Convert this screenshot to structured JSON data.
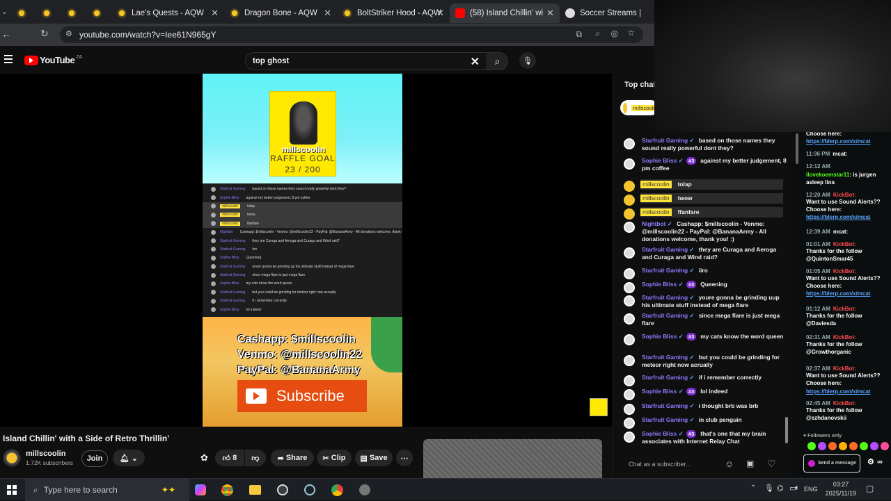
{
  "browser": {
    "tabs": [
      {
        "label": "",
        "active": false
      },
      {
        "label": "",
        "active": false
      },
      {
        "label": "",
        "active": false
      },
      {
        "label": "",
        "active": false
      },
      {
        "label": "Lae's Quests - AQW",
        "active": false
      },
      {
        "label": "Dragon Bone - AQW",
        "active": false
      },
      {
        "label": "BoltStriker Hood - AQW",
        "active": false
      },
      {
        "label": "(58) Island Chillin' wi",
        "active": true
      },
      {
        "label": "Soccer Streams | Watch",
        "active": false
      }
    ],
    "url": "youtube.com/watch?v=Iee61N965gY"
  },
  "youtube": {
    "logo_text": "YouTube",
    "region": "ZA",
    "search_value": "top ghost"
  },
  "video": {
    "poster_name": "millscoolin",
    "poster_goal": "RAFFLE GOAL",
    "poster_count": "23 / 200",
    "donate_cashapp": "Cashapp: $millscoolin",
    "donate_venmo": "Venmo: @millscoolin22",
    "donate_paypal": "PayPal: @BananaArmy",
    "subscribe": "Subscribe",
    "mini_chat": [
      {
        "name": "Starfruit Gaming",
        "text": "based on those names they sound really powerful dont they?",
        "hl": false,
        "y": false
      },
      {
        "name": "Sophie Bliss",
        "text": "against my better judgement, 8 pm coffee",
        "hl": false,
        "y": false
      },
      {
        "name": "millscoolin",
        "text": "tolap",
        "hl": true,
        "y": true
      },
      {
        "name": "millscoolin",
        "text": "twow",
        "hl": true,
        "y": true
      },
      {
        "name": "millscoolin",
        "text": "ffanfare",
        "hl": true,
        "y": true
      },
      {
        "name": "Nightbot",
        "text": "Cashapp: $millscoolin - Venmo: @millscoolin22 - PayPal: @BananaArmy - All donations welcome, thank you! :)",
        "hl": false,
        "y": false
      },
      {
        "name": "Starfruit Gaming",
        "text": "they are Curaga and Aeroga and Curaga and Wind raid?",
        "hl": false,
        "y": false
      },
      {
        "name": "Starfruit Gaming",
        "text": "iiro",
        "hl": false,
        "y": false
      },
      {
        "name": "Sophie Bliss",
        "text": "Queening",
        "hl": false,
        "y": false
      },
      {
        "name": "Starfruit Gaming",
        "text": "youre gonna be grinding up his ultimate stuff instead of mega flare",
        "hl": false,
        "y": false
      },
      {
        "name": "Starfruit Gaming",
        "text": "since mega flare is just mega flare",
        "hl": false,
        "y": false
      },
      {
        "name": "Sophie Bliss",
        "text": "my cats know the word queen",
        "hl": false,
        "y": false
      },
      {
        "name": "Starfruit Gaming",
        "text": "but you could be grinding for meteor right now acrually",
        "hl": false,
        "y": false
      },
      {
        "name": "Starfruit Gaming",
        "text": "if i remember correctly",
        "hl": false,
        "y": false
      },
      {
        "name": "Sophie Bliss",
        "text": "lol indeed",
        "hl": false,
        "y": false
      }
    ]
  },
  "below": {
    "title": "Island Chillin' with a Side of Retro Thrillin'",
    "channel": "millscoolin",
    "subscribers": "1.72K subscribers",
    "join": "Join",
    "likes": "8",
    "share": "Share",
    "clip": "Clip",
    "save": "Save"
  },
  "chat": {
    "header": "Top chat",
    "pinned_name": "millscoolin",
    "messages": [
      {
        "name": "Starfruit Gaming",
        "badge": "",
        "text": "based on those names they sound really powerful dont they?",
        "y": false
      },
      {
        "name": "Sophie Bliss",
        "badge": "#3",
        "text": "against my better judgement, 8 pm coffee",
        "y": false
      },
      {
        "name": "millscoolin",
        "badge": "",
        "text": "tolap",
        "y": true
      },
      {
        "name": "millscoolin",
        "badge": "",
        "text": "twow",
        "y": true
      },
      {
        "name": "millscoolin",
        "badge": "",
        "text": "ffanfare",
        "y": true
      },
      {
        "name": "Nightbot",
        "badge": "",
        "text": "Cashapp: $millscoolin - Venmo: @millscoolin22 - PayPal: @BananaArmy - All donations welcome, thank you! :)",
        "y": false
      },
      {
        "name": "Starfruit Gaming",
        "badge": "",
        "text": "they are Curaga and Aeroga and Curaga and Wind raid?",
        "y": false
      },
      {
        "name": "Starfruit Gaming",
        "badge": "",
        "text": "iiro",
        "y": false
      },
      {
        "name": "Sophie Bliss",
        "badge": "#3",
        "text": "Queening",
        "y": false
      },
      {
        "name": "Starfruit Gaming",
        "badge": "",
        "text": "youre gonna be grinding uup his ultimate stuff instead of mega flare",
        "y": false
      },
      {
        "name": "Starfruit Gaming",
        "badge": "",
        "text": "since mega flare is just mega flare",
        "y": false
      },
      {
        "name": "Sophie Bliss",
        "badge": "#3",
        "text": "my cats know the word queen",
        "y": false
      },
      {
        "name": "Starfruit Gaming",
        "badge": "",
        "text": "but you could be grinding for meteor right now acrually",
        "y": false
      },
      {
        "name": "Starfruit Gaming",
        "badge": "",
        "text": "if i remember correctly",
        "y": false
      },
      {
        "name": "Sophie Bliss",
        "badge": "#3",
        "text": "lol indeed",
        "y": false
      },
      {
        "name": "Starfruit Gaming",
        "badge": "",
        "text": "i thought brb was brb",
        "y": false
      },
      {
        "name": "Starfruit Gaming",
        "badge": "",
        "text": "in club penguin",
        "y": false
      },
      {
        "name": "Sophie Bliss",
        "badge": "#3",
        "text": "that's one that my brain associates with Internet Relay Chat",
        "y": false
      }
    ],
    "input_placeholder": "Chat as a subscriber..."
  },
  "kick": {
    "lines": [
      {
        "t": "",
        "n": "",
        "text": "Choose here:"
      },
      {
        "t": "",
        "n": "",
        "link": "https://blerp.com/x/mcat"
      },
      {
        "t": "11:36 PM",
        "n": "mcat:",
        "text": ""
      },
      {
        "t": "12:12 AM",
        "n": "",
        "text": ""
      },
      {
        "t": "",
        "n": "ilovekoemstar11",
        "text": ": is jurgen asleep lina"
      },
      {
        "t": "12:20 AM",
        "n": "KickBot:",
        "text": ""
      },
      {
        "t": "",
        "n": "",
        "text": "Want to use Sound Alerts?? Choose here:"
      },
      {
        "t": "",
        "n": "",
        "link": "https://blerp.com/x/mcat"
      },
      {
        "t": "12:39 AM",
        "n": "mcat:",
        "text": ""
      },
      {
        "t": "01:01 AM",
        "n": "KickBot:",
        "text": ""
      },
      {
        "t": "",
        "n": "",
        "text": "Thanks for the follow @QuintonSmar45"
      },
      {
        "t": "01:05 AM",
        "n": "KickBot:",
        "text": ""
      },
      {
        "t": "",
        "n": "",
        "text": "Want to use Sound Alerts?? Choose here:"
      },
      {
        "t": "",
        "n": "",
        "link": "https://blerp.com/x/mcat"
      },
      {
        "t": "01:12 AM",
        "n": "KickBot:",
        "text": ""
      },
      {
        "t": "",
        "n": "",
        "text": "Thanks for the follow @Daviesda"
      },
      {
        "t": "02:31 AM",
        "n": "KickBot:",
        "text": ""
      },
      {
        "t": "",
        "n": "",
        "text": "Thanks for the follow @Growthorganic"
      },
      {
        "t": "02:37 AM",
        "n": "KickBot:",
        "text": ""
      },
      {
        "t": "",
        "n": "",
        "text": "Want to use Sound Alerts?? Choose here:"
      },
      {
        "t": "",
        "n": "",
        "link": "https://blerp.com/x/mcat"
      },
      {
        "t": "02:45 AM",
        "n": "KickBot:",
        "text": ""
      },
      {
        "t": "",
        "n": "",
        "text": "Thanks for the follow @szhdanovskii"
      }
    ],
    "followers_only": "Followers only",
    "send": "Send a message"
  },
  "taskbar": {
    "search_placeholder": "Type here to search",
    "lang": "ENG",
    "time": "03:27",
    "date": "2025/11/19"
  }
}
